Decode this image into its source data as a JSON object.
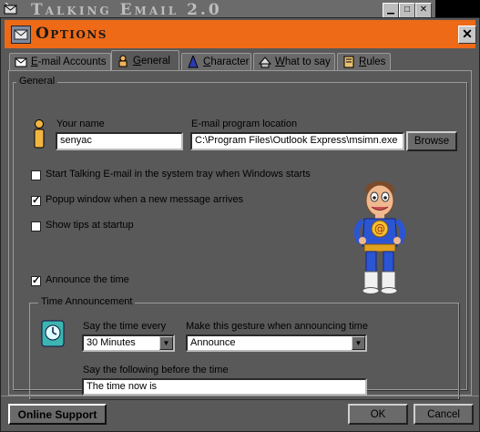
{
  "background_window": {
    "title": "Talking Email 2.0"
  },
  "dialog": {
    "title": "Options"
  },
  "tabs": [
    {
      "label": "E-mail Accounts"
    },
    {
      "label": "General"
    },
    {
      "label": "Character"
    },
    {
      "label": "What to say"
    },
    {
      "label": "Rules"
    }
  ],
  "general": {
    "group_title": "General",
    "your_name": {
      "label": "Your name",
      "value": "senyac"
    },
    "email_program": {
      "label": "E-mail program location",
      "value": "C:\\Program Files\\Outlook Express\\msimn.exe"
    },
    "browse_label": "Browse",
    "options": [
      {
        "label": "Start Talking E-mail in the system tray when Windows starts",
        "checked": false
      },
      {
        "label": "Popup window when a new message arrives",
        "checked": true
      },
      {
        "label": "Show tips at startup",
        "checked": false
      }
    ],
    "announce": {
      "label": "Announce the time",
      "checked": true
    }
  },
  "time_announcement": {
    "group_title": "Time Announcement",
    "every_label": "Say the time every",
    "every_value": "30 Minutes",
    "gesture_label": "Make this gesture when announcing time",
    "gesture_value": "Announce",
    "before_label": "Say the following before the time",
    "before_value": "The time now is"
  },
  "footer": {
    "online_support": "Online Support",
    "ok": "OK",
    "cancel": "Cancel"
  },
  "colors": {
    "titlebar": "#ee6a17",
    "dialog_bg": "#595959"
  }
}
